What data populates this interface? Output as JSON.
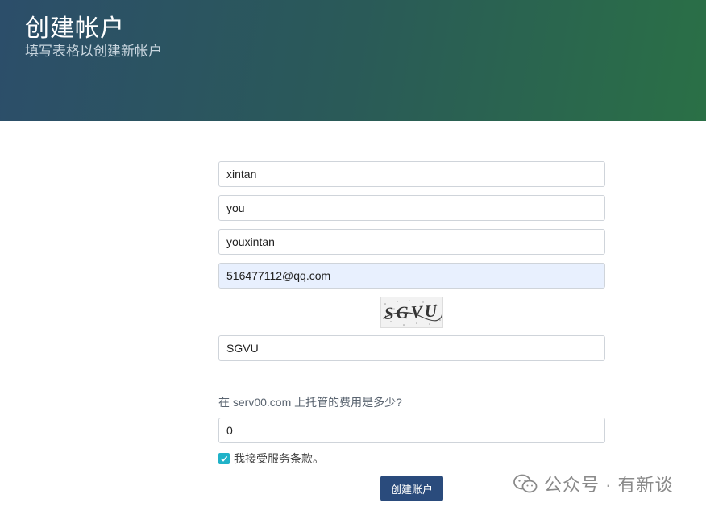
{
  "header": {
    "title": "创建帐户",
    "subtitle": "填写表格以创建新帐户"
  },
  "form": {
    "first_name": "xintan",
    "last_name": "you",
    "username": "youxintan",
    "email": "516477112@qq.com",
    "captcha_text": "SGVU",
    "captcha_input": "SGVU",
    "question": "在 serv00.com 上托管的费用是多少?",
    "answer": "0",
    "terms_label": "我接受服务条款。",
    "terms_checked": true,
    "submit_label": "创建账户"
  },
  "watermark": {
    "text": "公众号 · 有新谈"
  },
  "colors": {
    "header_start": "#2c4e6a",
    "header_end": "#2a7046",
    "button": "#2a4b7c",
    "checkbox": "#20b2c8",
    "autofill": "#e8f0fe"
  }
}
